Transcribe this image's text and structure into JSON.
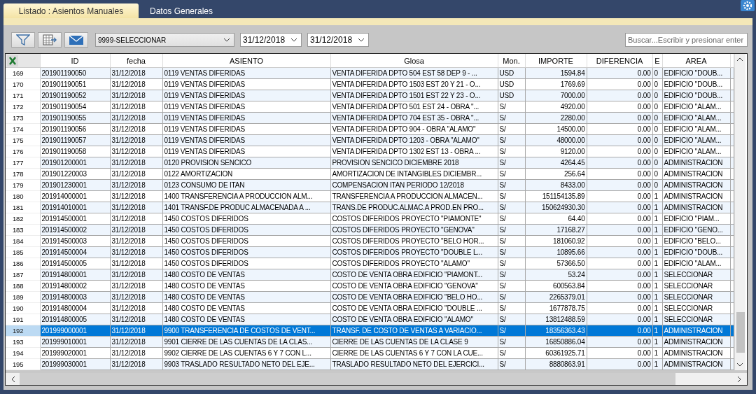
{
  "tabs": [
    {
      "label": "Listado : Asientos Manuales",
      "selected": true
    },
    {
      "label": "Datos Generales",
      "selected": false
    }
  ],
  "toolbar": {
    "series_select": "9999-SELECCIONAR",
    "date_from": "31/12/2018",
    "date_to": "31/12/2018",
    "search": {
      "placeholder": "Buscar...Escribir y presionar enter"
    }
  },
  "table": {
    "columns": [
      "ID",
      "fecha",
      "ASIENTO",
      "Glosa",
      "Mon.",
      "IMPORTE",
      "DIFERENCIA",
      "E",
      "AREA"
    ],
    "rows": [
      {
        "n": "169",
        "id": "201901190050",
        "fecha": "31/12/2018",
        "asiento": "0119 VENTAS DIFERIDAS",
        "glosa": "VENTA DIFERIDA DPTO 504 EST 58 DEP 9 - ...",
        "mon": "USD",
        "importe": "1594.84",
        "diferencia": "0.00",
        "e": "0",
        "area": "EDIFICIO \"DOUB...",
        "selected": false
      },
      {
        "n": "170",
        "id": "201901190051",
        "fecha": "31/12/2018",
        "asiento": "0119 VENTAS DIFERIDAS",
        "glosa": "VENTA DIFERIDA DPTO 1503 EST 20 Y 21 - O...",
        "mon": "USD",
        "importe": "1769.69",
        "diferencia": "0.00",
        "e": "0",
        "area": "EDIFICIO \"DOUB...",
        "selected": false
      },
      {
        "n": "171",
        "id": "201901190052",
        "fecha": "31/12/2018",
        "asiento": "0119 VENTAS DIFERIDAS",
        "glosa": "VENTA DIFERIDA DPTO 1501 EST 22 Y 23 - O...",
        "mon": "USD",
        "importe": "7000.00",
        "diferencia": "0.00",
        "e": "0",
        "area": "EDIFICIO \"DOUB...",
        "selected": false
      },
      {
        "n": "172",
        "id": "201901190054",
        "fecha": "31/12/2018",
        "asiento": "0119 VENTAS DIFERIDAS",
        "glosa": "VENTA DIFERIDA DPTO 501 EST 24 - OBRA \"...",
        "mon": "S/",
        "importe": "4920.00",
        "diferencia": "0.00",
        "e": "0",
        "area": "EDIFICIO \"ALAM...",
        "selected": false
      },
      {
        "n": "173",
        "id": "201901190055",
        "fecha": "31/12/2018",
        "asiento": "0119 VENTAS DIFERIDAS",
        "glosa": "VENTA DIFERIDA DPTO 704 EST 35 - OBRA \"...",
        "mon": "S/",
        "importe": "2280.00",
        "diferencia": "0.00",
        "e": "0",
        "area": "EDIFICIO \"ALAM...",
        "selected": false
      },
      {
        "n": "174",
        "id": "201901190056",
        "fecha": "31/12/2018",
        "asiento": "0119 VENTAS DIFERIDAS",
        "glosa": "VENTA DIFERIDA DPTO 904 - OBRA \"ALAMO\"",
        "mon": "S/",
        "importe": "14500.00",
        "diferencia": "0.00",
        "e": "0",
        "area": "EDIFICIO \"ALAM...",
        "selected": false
      },
      {
        "n": "175",
        "id": "201901190057",
        "fecha": "31/12/2018",
        "asiento": "0119 VENTAS DIFERIDAS",
        "glosa": "VENTA DIFERIDA DPTO 1203 - OBRA \"ALAMO\"",
        "mon": "S/",
        "importe": "48000.00",
        "diferencia": "0.00",
        "e": "0",
        "area": "EDIFICIO \"ALAM...",
        "selected": false
      },
      {
        "n": "176",
        "id": "201901190058",
        "fecha": "31/12/2018",
        "asiento": "0119 VENTAS DIFERIDAS",
        "glosa": "VENTA DIFERIDA DPTO 1302 EST 13 - OBRA ...",
        "mon": "S/",
        "importe": "9120.00",
        "diferencia": "0.00",
        "e": "0",
        "area": "EDIFICIO \"ALAM...",
        "selected": false
      },
      {
        "n": "177",
        "id": "201901200001",
        "fecha": "31/12/2018",
        "asiento": "0120 PROVISION SENCICO",
        "glosa": "PROVISION SENCICO DICIEMBRE 2018",
        "mon": "S/",
        "importe": "4264.45",
        "diferencia": "0.00",
        "e": "0",
        "area": "ADMINISTRACION",
        "selected": false
      },
      {
        "n": "178",
        "id": "201901220003",
        "fecha": "31/12/2018",
        "asiento": "0122 AMORTIZACION",
        "glosa": "AMORTIZACION  DE INTANGIBLES DICIEMBR...",
        "mon": "S/",
        "importe": "256.64",
        "diferencia": "0.00",
        "e": "0",
        "area": "ADMINISTRACION",
        "selected": false
      },
      {
        "n": "179",
        "id": "201901230001",
        "fecha": "31/12/2018",
        "asiento": "0123 CONSUMO DE ITAN",
        "glosa": "COMPENSACION ITAN PERIODO 12/2018",
        "mon": "S/",
        "importe": "8433.00",
        "diferencia": "0.00",
        "e": "0",
        "area": "ADMINISTRACION",
        "selected": false
      },
      {
        "n": "180",
        "id": "201914000001",
        "fecha": "31/12/2018",
        "asiento": "1400 TRANSFERENCIA A PRODUCCION ALM...",
        "glosa": "TRANSFERENCIA A PRODUCCION ALMACEN...",
        "mon": "S/",
        "importe": "151154135.89",
        "diferencia": "0.00",
        "e": "1",
        "area": "ADMINISTRACION",
        "selected": false
      },
      {
        "n": "181",
        "id": "201914010001",
        "fecha": "31/12/2018",
        "asiento": "1401 TRANSF.DE PRODUC ALMACENADA  A ...",
        "glosa": "TRANS.DE PRODUC.ALMAC.A PROD.EN PRO...",
        "mon": "S/",
        "importe": "150624930.30",
        "diferencia": "0.00",
        "e": "1",
        "area": "ADMINISTRACION",
        "selected": false
      },
      {
        "n": "182",
        "id": "201914500001",
        "fecha": "31/12/2018",
        "asiento": "1450 COSTOS DIFERIDOS",
        "glosa": "COSTOS DIFERIDOS PROYECTO \"PIAMONTE\"",
        "mon": "S/",
        "importe": "64.40",
        "diferencia": "0.00",
        "e": "1",
        "area": "EDIFICIO \"PIAM...",
        "selected": false
      },
      {
        "n": "183",
        "id": "201914500002",
        "fecha": "31/12/2018",
        "asiento": "1450 COSTOS DIFERIDOS",
        "glosa": "COSTOS DIFERIDOS PROYECTO \"GENOVA\"",
        "mon": "S/",
        "importe": "17168.27",
        "diferencia": "0.00",
        "e": "1",
        "area": "EDIFICIO \"GENO...",
        "selected": false
      },
      {
        "n": "184",
        "id": "201914500003",
        "fecha": "31/12/2018",
        "asiento": "1450 COSTOS DIFERIDOS",
        "glosa": "COSTOS DIFERIDOS PROYECTO \"BELO HOR...",
        "mon": "S/",
        "importe": "181060.92",
        "diferencia": "0.00",
        "e": "1",
        "area": "EDIFICIO \"BELO...",
        "selected": false
      },
      {
        "n": "185",
        "id": "201914500004",
        "fecha": "31/12/2018",
        "asiento": "1450 COSTOS DIFERIDOS",
        "glosa": "COSTOS DIFERIDOS PROYECTO \"DOUBLE L...",
        "mon": "S/",
        "importe": "10895.66",
        "diferencia": "0.00",
        "e": "1",
        "area": "EDIFICIO \"DOUB...",
        "selected": false
      },
      {
        "n": "186",
        "id": "201914500005",
        "fecha": "31/12/2018",
        "asiento": "1450 COSTOS DIFERIDOS",
        "glosa": "COSTOS DIFERIDOS PROYECTO \"ALAMO\"",
        "mon": "S/",
        "importe": "57366.50",
        "diferencia": "0.00",
        "e": "1",
        "area": "EDIFICIO \"ALAM...",
        "selected": false
      },
      {
        "n": "187",
        "id": "201914800001",
        "fecha": "31/12/2018",
        "asiento": "1480 COSTO DE VENTAS",
        "glosa": "COSTO DE VENTA OBRA EDIFICIO \"PIAMONT...",
        "mon": "S/",
        "importe": "53.24",
        "diferencia": "0.00",
        "e": "1",
        "area": "SELECCIONAR",
        "selected": false
      },
      {
        "n": "188",
        "id": "201914800002",
        "fecha": "31/12/2018",
        "asiento": "1480 COSTO DE VENTAS",
        "glosa": "COSTO DE VENTA OBRA EDIFICIO \"GENOVA\"",
        "mon": "S/",
        "importe": "600563.84",
        "diferencia": "0.00",
        "e": "1",
        "area": "SELECCIONAR",
        "selected": false
      },
      {
        "n": "189",
        "id": "201914800003",
        "fecha": "31/12/2018",
        "asiento": "1480 COSTO DE VENTAS",
        "glosa": "COSTO DE VENTA OBRA EDIFICIO \"BELO HO...",
        "mon": "S/",
        "importe": "2265379.01",
        "diferencia": "0.00",
        "e": "1",
        "area": "SELECCIONAR",
        "selected": false
      },
      {
        "n": "190",
        "id": "201914800004",
        "fecha": "31/12/2018",
        "asiento": "1480 COSTO DE VENTAS",
        "glosa": "COSTO DE VENTA OBRA EDIFICIO \"DOUBLE ...",
        "mon": "S/",
        "importe": "1677878.75",
        "diferencia": "0.00",
        "e": "1",
        "area": "SELECCIONAR",
        "selected": false
      },
      {
        "n": "191",
        "id": "201914800005",
        "fecha": "31/12/2018",
        "asiento": "1480 COSTO DE VENTAS",
        "glosa": "COSTO DE VENTA OBRA EDIFICIO \"ALAMO\"",
        "mon": "S/",
        "importe": "13812488.59",
        "diferencia": "0.00",
        "e": "1",
        "area": "SELECCIONAR",
        "selected": false
      },
      {
        "n": "192",
        "id": "201999000001",
        "fecha": "31/12/2018",
        "asiento": "9900 TRANSFERENCIA DE COSTOS DE VENT...",
        "glosa": "TRANSF. DE COSTO DE VENTAS A VARIACIO...",
        "mon": "S/",
        "importe": "18356363.43",
        "diferencia": "0.00",
        "e": "1",
        "area": "ADMINISTRACION",
        "selected": true
      },
      {
        "n": "193",
        "id": "201999010001",
        "fecha": "31/12/2018",
        "asiento": "9901 CIERRE DE LAS CUENTAS DE LA CLAS...",
        "glosa": "CIERRE DE LAS CUENTAS DE LA CLASE 9",
        "mon": "S/",
        "importe": "16850886.04",
        "diferencia": "0.00",
        "e": "1",
        "area": "ADMINISTRACION",
        "selected": false
      },
      {
        "n": "194",
        "id": "201999020001",
        "fecha": "31/12/2018",
        "asiento": "9902 CIERRE DE LAS CUENTAS 6 Y 7 CON  L...",
        "glosa": "CIERRE DE LAS CUENTAS 6 Y 7 CON LA CUE...",
        "mon": "S/",
        "importe": "60361925.71",
        "diferencia": "0.00",
        "e": "1",
        "area": "ADMINISTRACION",
        "selected": false
      },
      {
        "n": "195",
        "id": "201999030001",
        "fecha": "31/12/2018",
        "asiento": "9903 TRASLADO RESULTADO NETO DEL EJE...",
        "glosa": "TRASLADO RESULTADO NETO DEL EJERCICI...",
        "mon": "S/",
        "importe": "8880863.91",
        "diferencia": "0.00",
        "e": "1",
        "area": "ADMINISTRACION",
        "selected": false
      }
    ]
  }
}
